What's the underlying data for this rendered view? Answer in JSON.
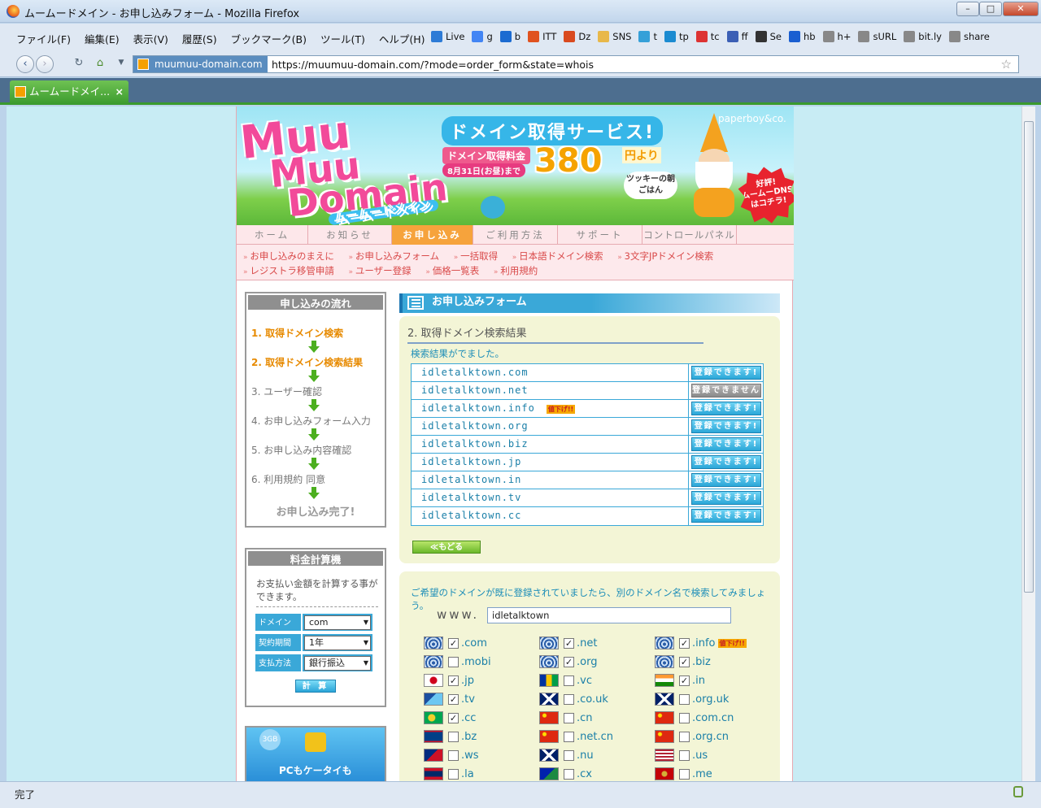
{
  "browser": {
    "window_title": "ムームードメイン - お申し込みフォーム - Mozilla Firefox",
    "menu": [
      "ファイル(F)",
      "編集(E)",
      "表示(V)",
      "履歴(S)",
      "ブックマーク(B)",
      "ツール(T)",
      "ヘルプ(H)"
    ],
    "bookmarks": [
      "Live",
      "g",
      "b",
      "ITT",
      "Dz",
      "SNS",
      "t",
      "tp",
      "tc",
      "ff",
      "Se",
      "hb",
      "h+",
      "sURL",
      "bit.ly",
      "share"
    ],
    "site_badge": "muumuu-domain.com",
    "url": "https://muumuu-domain.com/?mode=order_form&state=whois",
    "tab_label": "ムームードメイ...",
    "status": "完了"
  },
  "banner": {
    "logo_line1": "Muu",
    "logo_line2": "Muu",
    "logo_line3": "Domain",
    "logo_kana": "ムームードメイン",
    "headline": "ドメイン取得サービス!",
    "price_tag": "ドメイン取得料金",
    "date": "8月31日(お昼)まで",
    "price": "380",
    "price_suffix": "円より",
    "company": "paperboy&co.",
    "bubble": "ツッキーの朝ごはん",
    "dns_line1": "好評!",
    "dns_line2": "ムームーDNS",
    "dns_line3": "はコチラ!"
  },
  "global_nav": [
    "ホーム",
    "お知らせ",
    "お申し込み",
    "ご利用方法",
    "サポート",
    "コントロールパネル"
  ],
  "sub_nav": [
    "お申し込みのまえに",
    "お申し込みフォーム",
    "一括取得",
    "日本語ドメイン検索",
    "3文字JPドメイン検索",
    "レジストラ移管申請",
    "ユーザー登録",
    "価格一覧表",
    "利用規約"
  ],
  "flow": {
    "title": "申し込みの流れ",
    "steps": [
      "1. 取得ドメイン検索",
      "2. 取得ドメイン検索結果",
      "3. ユーザー確認",
      "4. お申し込みフォーム入力",
      "5. お申し込み内容確認",
      "6. 利用規約 同意"
    ],
    "done": "お申し込み完了!"
  },
  "calculator": {
    "title": "料金計算機",
    "description": "お支払い金額を計算する事ができます。",
    "domain_label": "ドメイン",
    "domain_value": "com",
    "period_label": "契約期間",
    "period_value": "1年",
    "pay_label": "支払方法",
    "pay_value": "銀行振込",
    "button": "計 算"
  },
  "promo": {
    "badge": "3GB",
    "text": "PCもケータイも"
  },
  "form": {
    "header": "お申し込みフォーム",
    "section_title": "2. 取得ドメイン検索結果",
    "message": "検索結果がでました。",
    "results": [
      {
        "domain": "idletalktown.com",
        "status": "登録できます!",
        "available": true,
        "badge": ""
      },
      {
        "domain": "idletalktown.net",
        "status": "登録できません",
        "available": false,
        "badge": ""
      },
      {
        "domain": "idletalktown.info",
        "status": "登録できます!",
        "available": true,
        "badge": "値下げ!!"
      },
      {
        "domain": "idletalktown.org",
        "status": "登録できます!",
        "available": true,
        "badge": ""
      },
      {
        "domain": "idletalktown.biz",
        "status": "登録できます!",
        "available": true,
        "badge": ""
      },
      {
        "domain": "idletalktown.jp",
        "status": "登録できます!",
        "available": true,
        "badge": ""
      },
      {
        "domain": "idletalktown.in",
        "status": "登録できます!",
        "available": true,
        "badge": ""
      },
      {
        "domain": "idletalktown.tv",
        "status": "登録できます!",
        "available": true,
        "badge": ""
      },
      {
        "domain": "idletalktown.cc",
        "status": "登録できます!",
        "available": true,
        "badge": ""
      }
    ],
    "back_button": "≪もどる"
  },
  "search": {
    "message": "ご希望のドメインが既に登録されていましたら、別のドメイン名で検索してみましょう。",
    "www": "www.",
    "query": "idletalktown",
    "tlds": [
      {
        "name": ".com",
        "checked": true,
        "badge": "",
        "flag": "globe"
      },
      {
        "name": ".net",
        "checked": true,
        "badge": "",
        "flag": "globe"
      },
      {
        "name": ".info",
        "checked": true,
        "badge": "値下げ!!",
        "flag": "globe"
      },
      {
        "name": ".mobi",
        "checked": false,
        "badge": "",
        "flag": "globe"
      },
      {
        "name": ".org",
        "checked": true,
        "badge": "",
        "flag": "globe"
      },
      {
        "name": ".biz",
        "checked": true,
        "badge": "",
        "flag": "globe"
      },
      {
        "name": ".jp",
        "checked": true,
        "badge": "",
        "flag": "jp"
      },
      {
        "name": ".vc",
        "checked": false,
        "badge": "",
        "flag": "vc"
      },
      {
        "name": ".in",
        "checked": true,
        "badge": "",
        "flag": "in"
      },
      {
        "name": ".tv",
        "checked": true,
        "badge": "",
        "flag": "tv"
      },
      {
        "name": ".co.uk",
        "checked": false,
        "badge": "",
        "flag": "uk"
      },
      {
        "name": ".org.uk",
        "checked": false,
        "badge": "",
        "flag": "uk"
      },
      {
        "name": ".cc",
        "checked": true,
        "badge": "",
        "flag": "cc"
      },
      {
        "name": ".cn",
        "checked": false,
        "badge": "",
        "flag": "cn"
      },
      {
        "name": ".com.cn",
        "checked": false,
        "badge": "",
        "flag": "cn"
      },
      {
        "name": ".bz",
        "checked": false,
        "badge": "",
        "flag": "bz"
      },
      {
        "name": ".net.cn",
        "checked": false,
        "badge": "",
        "flag": "cn"
      },
      {
        "name": ".org.cn",
        "checked": false,
        "badge": "",
        "flag": "cn"
      },
      {
        "name": ".ws",
        "checked": false,
        "badge": "",
        "flag": "ws"
      },
      {
        "name": ".nu",
        "checked": false,
        "badge": "",
        "flag": "uk"
      },
      {
        "name": ".us",
        "checked": false,
        "badge": "",
        "flag": "us"
      },
      {
        "name": ".la",
        "checked": false,
        "badge": "",
        "flag": "la"
      },
      {
        "name": ".cx",
        "checked": false,
        "badge": "",
        "flag": "cx"
      },
      {
        "name": ".me",
        "checked": false,
        "badge": "",
        "flag": "me"
      }
    ]
  },
  "colors": {
    "accent_blue": "#3aa8d8",
    "brand_pink": "#f24a9a",
    "nav_active": "#f6a33c",
    "panel_bg": "#f3f5d6"
  }
}
